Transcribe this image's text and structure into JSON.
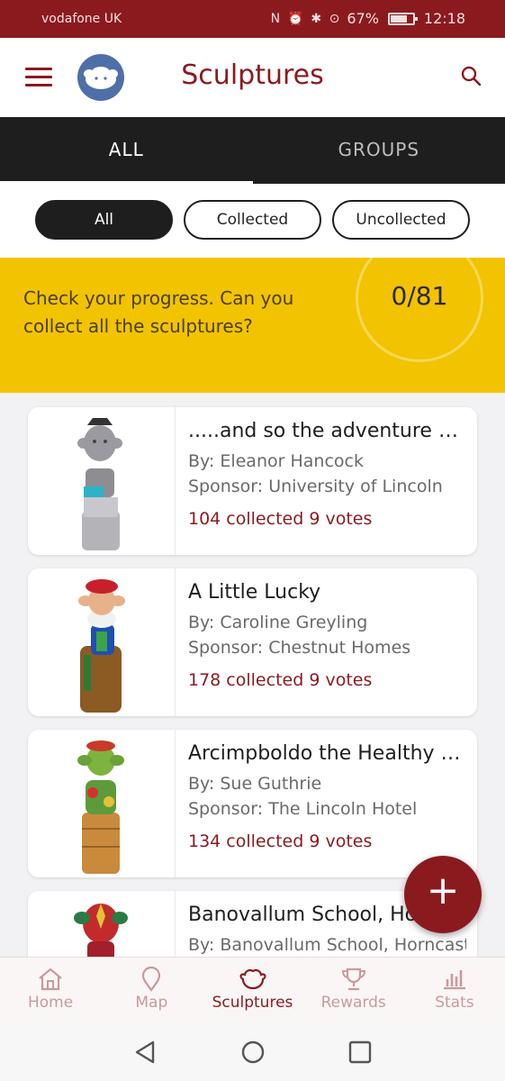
{
  "status_bar": {
    "carrier": "vodafone UK",
    "battery": "67%",
    "time": "12:18"
  },
  "header": {
    "title": "Sculptures"
  },
  "tabs": [
    {
      "label": "ALL",
      "active": true
    },
    {
      "label": "GROUPS",
      "active": false
    }
  ],
  "filters": [
    {
      "label": "All",
      "active": true
    },
    {
      "label": "Collected",
      "active": false
    },
    {
      "label": "Uncollected",
      "active": false
    }
  ],
  "progress": {
    "text": "Check your progress. Can you collect all the sculptures?",
    "count": "0/81"
  },
  "sculptures": [
    {
      "title": ".....and so the adventure begins",
      "by": "By: Eleanor Hancock",
      "sponsor": "Sponsor: University of Lincoln",
      "collected": "104 collected",
      "votes": "9 votes"
    },
    {
      "title": "A Little Lucky",
      "by": "By: Caroline Greyling",
      "sponsor": "Sponsor: Chestnut Homes",
      "collected": "178 collected",
      "votes": "9 votes"
    },
    {
      "title": "Arcimpboldo the Healthy Imp",
      "by": "By: Sue Guthrie",
      "sponsor": "Sponsor: The Lincoln Hotel",
      "collected": "134 collected",
      "votes": "9 votes"
    },
    {
      "title": "Banovallum School, Horncastle",
      "by": "By: Banovallum School, Horncastle",
      "sponsor": "",
      "collected": "",
      "votes": ""
    }
  ],
  "fab": {
    "label": "+"
  },
  "bottom_nav": [
    {
      "label": "Home",
      "icon": "home-icon",
      "active": false
    },
    {
      "label": "Map",
      "icon": "map-pin-icon",
      "active": false
    },
    {
      "label": "Sculptures",
      "icon": "imp-icon",
      "active": true
    },
    {
      "label": "Rewards",
      "icon": "trophy-icon",
      "active": false
    },
    {
      "label": "Stats",
      "icon": "bar-chart-icon",
      "active": false
    }
  ],
  "colors": {
    "brand": "#8b1a1f",
    "banner": "#f2c300",
    "tabs_bg": "#1e1e1e"
  }
}
